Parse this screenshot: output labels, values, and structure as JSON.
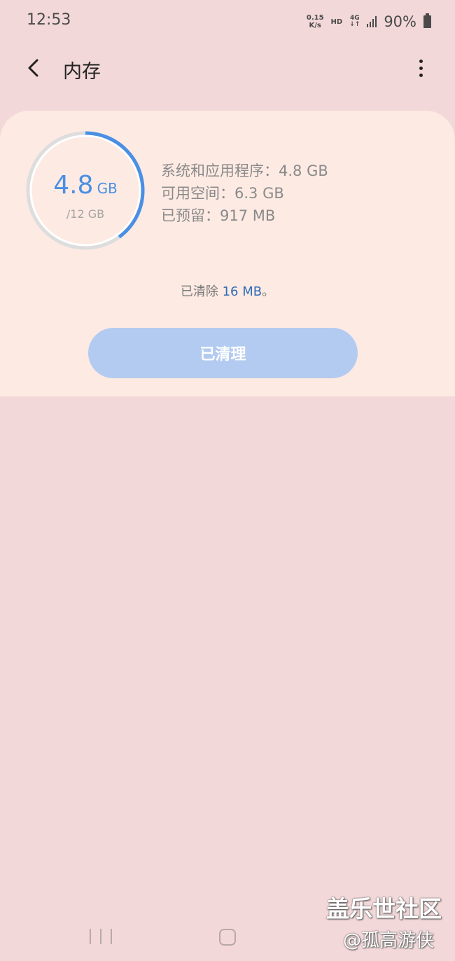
{
  "status_bar": {
    "time": "12:53",
    "net_speed_value": "0.15",
    "net_speed_unit": "K/s",
    "hd": "HD",
    "network_type": "4G",
    "network_arrows": "↓↑",
    "battery": "90%"
  },
  "app_bar": {
    "title": "内存"
  },
  "memory": {
    "used_value": "4.8",
    "used_unit": "GB",
    "total": "/12 GB",
    "used_fraction": 0.4,
    "system_apps": "系统和应用程序：4.8 GB",
    "available": "可用空间：6.3 GB",
    "reserved": "已预留：917 MB",
    "cleared_prefix": "已清除 ",
    "cleared_amount": "16 MB",
    "cleared_suffix": "。",
    "button_label": "已清理"
  },
  "watermark": {
    "line1": "盖乐世社区",
    "line2": "@孤高游侠"
  },
  "colors": {
    "accent": "#4a8fe4",
    "ring_track": "#dddddd",
    "card_bg": "#fdeae3",
    "page_bg": "#f3d8d9",
    "button_bg": "#b3cbf0"
  }
}
